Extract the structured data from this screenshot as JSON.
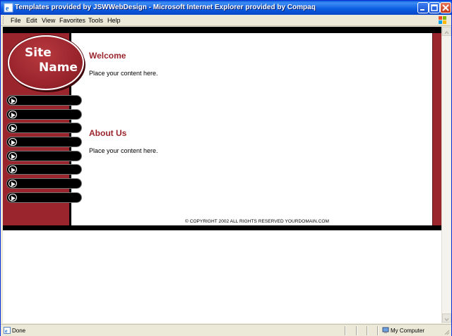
{
  "window": {
    "title": "Templates provided by JSWWebDesign - Microsoft Internet Explorer provided by Compaq"
  },
  "menubar": {
    "items": [
      "File",
      "Edit",
      "View",
      "Favorites",
      "Tools",
      "Help"
    ]
  },
  "page": {
    "logo": {
      "line1": "Site",
      "line2": "Name"
    },
    "nav_count": 8,
    "sections": [
      {
        "heading": "Welcome",
        "text": "Place your content here."
      },
      {
        "heading": "About Us",
        "text": "Place your content here."
      }
    ],
    "copyright": "© COPYRIGHT 2002 ALL RIGHTS RESERVED YOURDOMAIN.COM",
    "colors": {
      "accent": "#9b252d",
      "bar": "#000000"
    }
  },
  "statusbar": {
    "status": "Done",
    "zone": "My Computer"
  },
  "icons": [
    "ie-icon",
    "minimize-icon",
    "maximize-icon",
    "close-icon",
    "windows-logo-icon",
    "page-done-icon",
    "my-computer-icon",
    "play-arrow-icon"
  ]
}
